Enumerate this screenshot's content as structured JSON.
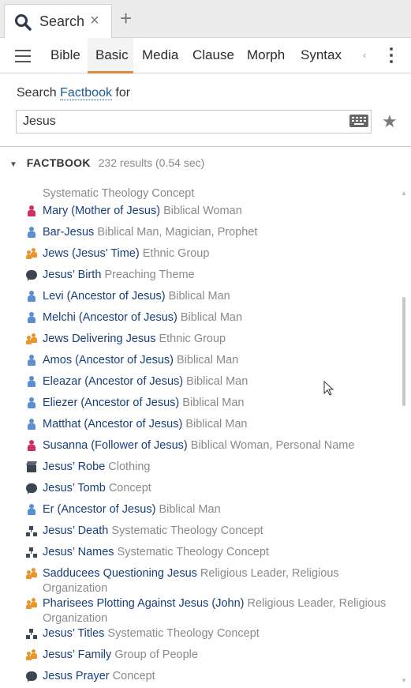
{
  "tabs": {
    "active_label": "Search",
    "close_symbol": "×",
    "new_tab_symbol": "+"
  },
  "toolbar": {
    "modes": [
      {
        "label": "Bible"
      },
      {
        "label": "Basic"
      },
      {
        "label": "Media"
      },
      {
        "label": "Clause"
      },
      {
        "label": "Morph"
      },
      {
        "label": "Syntax"
      }
    ],
    "active_mode": "Basic",
    "scroll_left_symbol": "‹"
  },
  "search": {
    "prefix": "Search",
    "scope_link": "Factbook",
    "suffix": "for",
    "query": "Jesus"
  },
  "results": {
    "section_title": "FACTBOOK",
    "count_text": "232 results (0.54 sec)",
    "clipped_top_text": "Systematic Theology Concept",
    "items": [
      {
        "title": "Mary (Mother of Jesus)",
        "kind": "Biblical Woman",
        "icon": "woman-icon"
      },
      {
        "title": "Bar-Jesus",
        "kind": "Biblical Man, Magician, Prophet",
        "icon": "man-icon"
      },
      {
        "title": "Jews (Jesus’ Time)",
        "kind": "Ethnic Group",
        "icon": "group-icon"
      },
      {
        "title": "Jesus’ Birth",
        "kind": "Preaching Theme",
        "icon": "speech-bubble-icon"
      },
      {
        "title": "Levi (Ancestor of Jesus)",
        "kind": "Biblical Man",
        "icon": "man-icon"
      },
      {
        "title": "Melchi (Ancestor of Jesus)",
        "kind": "Biblical Man",
        "icon": "man-icon"
      },
      {
        "title": "Jews Delivering Jesus",
        "kind": "Ethnic Group",
        "icon": "group-icon"
      },
      {
        "title": "Amos (Ancestor of Jesus)",
        "kind": "Biblical Man",
        "icon": "man-icon"
      },
      {
        "title": "Eleazar (Ancestor of Jesus)",
        "kind": "Biblical Man",
        "icon": "man-icon"
      },
      {
        "title": "Eliezer (Ancestor of Jesus)",
        "kind": "Biblical Man",
        "icon": "man-icon"
      },
      {
        "title": "Matthat (Ancestor of Jesus)",
        "kind": "Biblical Man",
        "icon": "man-icon"
      },
      {
        "title": "Susanna (Follower of Jesus)",
        "kind": "Biblical Woman, Personal Name",
        "icon": "woman-icon"
      },
      {
        "title": "Jesus’ Robe",
        "kind": "Clothing",
        "icon": "box-icon"
      },
      {
        "title": "Jesus’ Tomb",
        "kind": "Concept",
        "icon": "speech-bubble-icon"
      },
      {
        "title": "Er (Ancestor of Jesus)",
        "kind": "Biblical Man",
        "icon": "man-icon"
      },
      {
        "title": "Jesus’ Death",
        "kind": "Systematic Theology Concept",
        "icon": "hierarchy-icon"
      },
      {
        "title": "Jesus’ Names",
        "kind": "Systematic Theology Concept",
        "icon": "hierarchy-icon"
      },
      {
        "title": "Sadducees Questioning Jesus",
        "kind": "Religious Leader, Religious Organization",
        "icon": "group-icon"
      },
      {
        "title": "Pharisees Plotting Against Jesus (John)",
        "kind": "Religious Leader, Religious Organization",
        "icon": "group-icon"
      },
      {
        "title": "Jesus’ Titles",
        "kind": "Systematic Theology Concept",
        "icon": "hierarchy-icon"
      },
      {
        "title": "Jesus’ Family",
        "kind": "Group of People",
        "icon": "group-icon"
      },
      {
        "title": "Jesus Prayer",
        "kind": "Concept",
        "icon": "speech-bubble-icon"
      }
    ]
  },
  "colors": {
    "accent": "#e08a3c",
    "link": "#173f7a",
    "man": "#5b8fd0",
    "woman": "#d0306a",
    "group": "#e8952c"
  }
}
